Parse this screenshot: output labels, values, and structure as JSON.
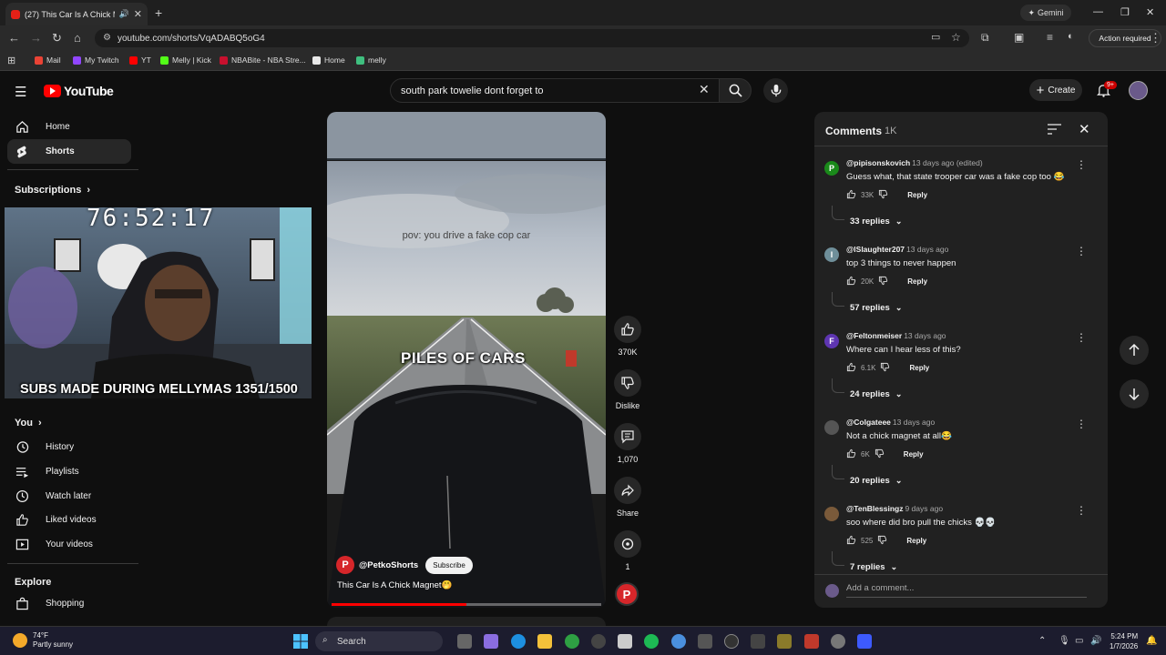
{
  "browser": {
    "tab_title": "(27) This Car Is A Chick Mag...",
    "url": "youtube.com/shorts/VqADABQ5oG4",
    "gemini_label": "Gemini",
    "action_required": "Action required",
    "bookmarks": [
      {
        "label": "Mail",
        "color": "#ea4335"
      },
      {
        "label": "My Twitch",
        "color": "#9146ff"
      },
      {
        "label": "YT",
        "color": "#ff0000"
      },
      {
        "label": "Melly | Kick",
        "color": "#53fc18"
      },
      {
        "label": "NBABite - NBA Stre...",
        "color": "#c8102e"
      },
      {
        "label": "Home",
        "color": "#e8e8e8"
      },
      {
        "label": "melly",
        "color": "#3fbf7f"
      }
    ]
  },
  "header": {
    "logo_text": "YouTube",
    "search_value": "south park towelie dont forget to",
    "create_label": "Create",
    "notification_badge": "9+"
  },
  "sidebar": {
    "items_top": [
      {
        "label": "Home",
        "icon": "home-icon"
      },
      {
        "label": "Shorts",
        "icon": "shorts-icon"
      }
    ],
    "subscriptions_heading": "Subscriptions",
    "you_heading": "You",
    "you_items": [
      {
        "label": "History",
        "icon": "history-icon"
      },
      {
        "label": "Playlists",
        "icon": "playlists-icon"
      },
      {
        "label": "Watch later",
        "icon": "watch-later-icon"
      },
      {
        "label": "Liked videos",
        "icon": "liked-videos-icon"
      },
      {
        "label": "Your videos",
        "icon": "your-videos-icon"
      }
    ],
    "explore_heading": "Explore",
    "explore_items": [
      {
        "label": "Shopping",
        "icon": "shopping-icon"
      }
    ]
  },
  "stream_overlay": {
    "timer": "76:52:17",
    "subs_text": "SUBS MADE DURING MELLYMAS 1351/1500"
  },
  "short": {
    "overlay_caption": "pov: you drive a fake cop car",
    "overlay_big_text": "PILES OF CARS",
    "channel": "@PetkoShorts",
    "subscribe_label": "Subscribe",
    "title": "This Car Is A Chick Magnet🤭",
    "progress_fraction": 0.5
  },
  "actions": {
    "likes": "370K",
    "dislike_label": "Dislike",
    "comments": "1,070",
    "share_label": "Share",
    "remix": "1"
  },
  "comments_panel": {
    "title": "Comments",
    "count": "1K",
    "items": [
      {
        "user": "@pipisonskovich",
        "ago": "13 days ago (edited)",
        "text": "Guess what, that state trooper car was a fake cop too 😂",
        "likes": "33K",
        "reply": "Reply",
        "replies": "33 replies",
        "avatar_letter": "P",
        "avatar_color": "#1a8a1a"
      },
      {
        "user": "@lSlaughter207",
        "ago": "13 days ago",
        "text": "top 3 things to never happen",
        "likes": "20K",
        "reply": "Reply",
        "replies": "57 replies",
        "avatar_letter": "I",
        "avatar_color": "#6f8f9a"
      },
      {
        "user": "@Feltonmeiser",
        "ago": "13 days ago",
        "text": "Where can I hear less of this?",
        "likes": "6.1K",
        "reply": "Reply",
        "replies": "24 replies",
        "avatar_letter": "F",
        "avatar_color": "#5e35b1"
      },
      {
        "user": "@Colgateee",
        "ago": "13 days ago",
        "text": "Not a chick magnet at all😂",
        "likes": "6K",
        "reply": "Reply",
        "replies": "20 replies",
        "avatar_letter": "",
        "avatar_color": "#555555"
      },
      {
        "user": "@TenBlessingz",
        "ago": "9 days ago",
        "text": "soo where did bro pull the chicks 💀💀",
        "likes": "525",
        "reply": "Reply",
        "replies": "7 replies",
        "avatar_letter": "",
        "avatar_color": "#7a5a3a"
      }
    ],
    "add_comment_placeholder": "Add a comment..."
  },
  "taskbar": {
    "temperature": "74°F",
    "weather": "Partly sunny",
    "search_label": "Search",
    "time": "5:24 PM",
    "date": "1/7/2026"
  }
}
